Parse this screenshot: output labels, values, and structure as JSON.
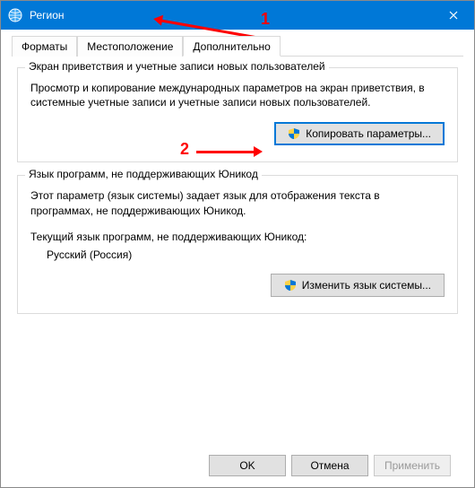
{
  "annotations": {
    "one": "1",
    "two": "2"
  },
  "titlebar": {
    "title": "Регион"
  },
  "tabs": [
    {
      "label": "Форматы"
    },
    {
      "label": "Местоположение"
    },
    {
      "label": "Дополнительно"
    }
  ],
  "group1": {
    "legend": "Экран приветствия и учетные записи новых пользователей",
    "desc": "Просмотр и копирование международных параметров на экран приветствия, в системные учетные записи и учетные записи новых пользователей.",
    "button": "Копировать параметры..."
  },
  "group2": {
    "legend": "Язык программ, не поддерживающих Юникод",
    "desc": "Этот параметр (язык системы) задает язык для отображения текста в программах, не поддерживающих Юникод.",
    "current_label": "Текущий язык программ, не поддерживающих Юникод:",
    "current_value": "Русский (Россия)",
    "button": "Изменить язык системы..."
  },
  "footer": {
    "ok": "OK",
    "cancel": "Отмена",
    "apply": "Применить"
  }
}
